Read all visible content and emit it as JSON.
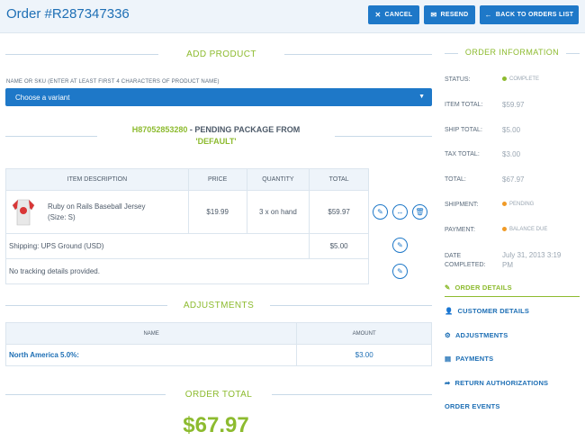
{
  "header": {
    "title": "Order #R287347336",
    "cancel": "CANCEL",
    "resend": "RESEND",
    "back": "BACK TO ORDERS LIST"
  },
  "add_product": {
    "title": "ADD PRODUCT",
    "field_label": "NAME OR SKU (ENTER AT LEAST FIRST 4 CHARACTERS OF PRODUCT NAME)",
    "select_value": "Choose a variant"
  },
  "package": {
    "number": "H87052853280",
    "title_rest": " - PENDING PACKAGE FROM",
    "stock_location": "'DEFAULT'"
  },
  "items_table": {
    "headers": [
      "ITEM DESCRIPTION",
      "PRICE",
      "QUANTITY",
      "TOTAL"
    ],
    "row": {
      "description": "Ruby on Rails Baseball Jersey (Size: S)",
      "price": "$19.99",
      "quantity": "3 x on hand",
      "total": "$59.97"
    },
    "shipping": {
      "label": "Shipping: UPS Ground (USD)",
      "total": "$5.00"
    },
    "tracking": "No tracking details provided."
  },
  "adjustments": {
    "title": "ADJUSTMENTS",
    "headers": [
      "NAME",
      "AMOUNT"
    ],
    "rows": [
      {
        "name": "North America 5.0%:",
        "amount": "$3.00"
      }
    ]
  },
  "order_total": {
    "title": "ORDER TOTAL",
    "value": "$67.97"
  },
  "order_info": {
    "title": "ORDER INFORMATION",
    "status_label": "STATUS:",
    "status": "COMPLETE",
    "item_total_label": "ITEM TOTAL:",
    "item_total": "$59.97",
    "ship_total_label": "SHIP TOTAL:",
    "ship_total": "$5.00",
    "tax_total_label": "TAX TOTAL:",
    "tax_total": "$3.00",
    "total_label": "TOTAL:",
    "total": "$67.97",
    "shipment_label": "SHIPMENT:",
    "shipment": "PENDING",
    "payment_label": "PAYMENT:",
    "payment": "BALANCE DUE",
    "date_label_1": "DATE",
    "date_label_2": "COMPLETED:",
    "date_1": "July 31, 2013 3:19",
    "date_2": "PM"
  },
  "nav": {
    "order_details": "ORDER DETAILS",
    "customer_details": "CUSTOMER DETAILS",
    "adjustments": "ADJUSTMENTS",
    "payments": "PAYMENTS",
    "return_authorizations": "RETURN AUTHORIZATIONS",
    "order_events": "ORDER EVENTS"
  },
  "colors": {
    "accent_blue": "#1e78c8",
    "accent_green": "#8dbb2f",
    "complete_dot": "#8dbb2f",
    "pending_dot": "#f09a26"
  },
  "icons": [
    "times-icon",
    "envelope-icon",
    "arrow-left-icon",
    "caret-down-icon",
    "edit-icon",
    "split-icon",
    "trash-icon",
    "user-icon",
    "cogs-icon",
    "payments-icon",
    "share-icon"
  ]
}
